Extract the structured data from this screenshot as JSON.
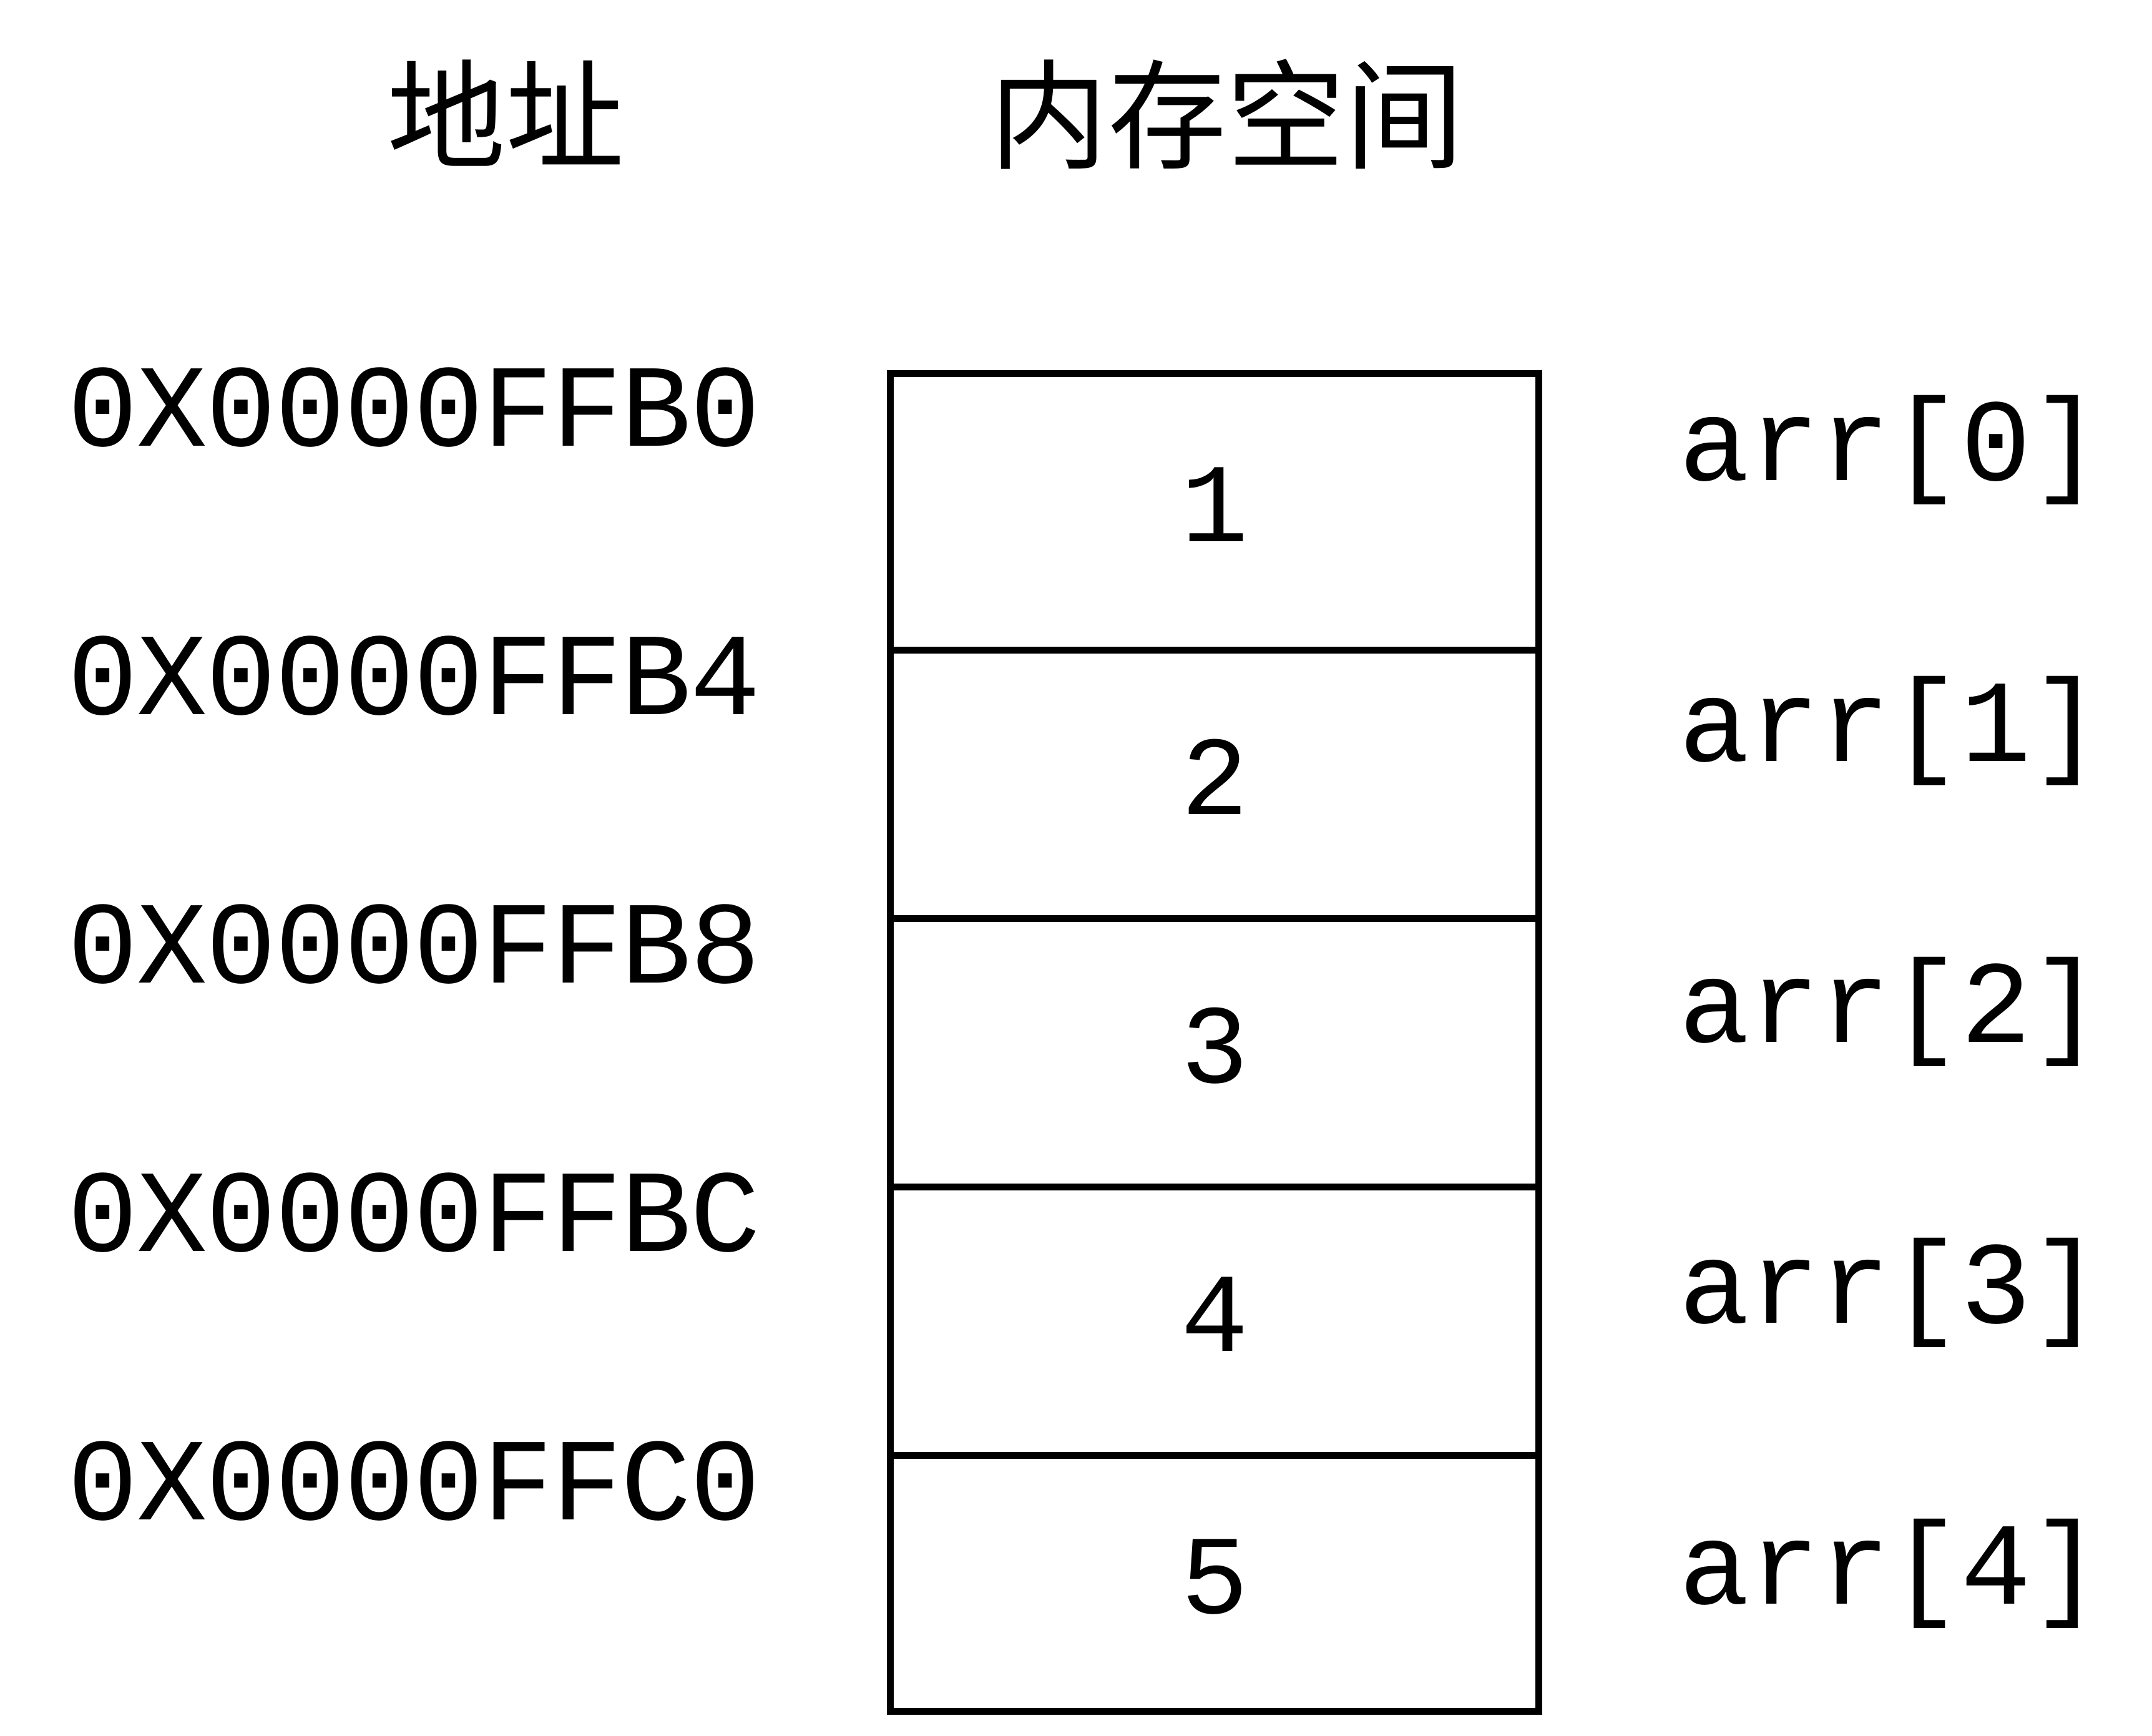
{
  "headers": {
    "address": "地址",
    "memory": "内存空间"
  },
  "addresses": [
    "0X0000FFB0",
    "0X0000FFB4",
    "0X0000FFB8",
    "0X0000FFBC",
    "0X0000FFC0"
  ],
  "cells": [
    "1",
    "2",
    "3",
    "4",
    "5"
  ],
  "labels": [
    "arr[0]",
    "arr[1]",
    "arr[2]",
    "arr[3]",
    "arr[4]"
  ]
}
